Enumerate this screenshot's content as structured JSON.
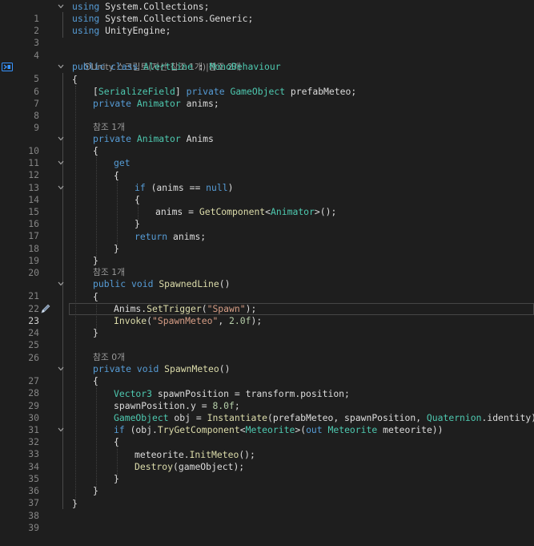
{
  "editor": {
    "lens": {
      "class_refs": "Unity 스크립트(자산 참조 1개)|참조 2개",
      "ref_1": "참조 1개",
      "ref_0": "참조 0개"
    },
    "line_numbers": [
      "1",
      "2",
      "3",
      "4",
      "5",
      "6",
      "7",
      "8",
      "9",
      "10",
      "11",
      "12",
      "13",
      "14",
      "15",
      "16",
      "17",
      "18",
      "19",
      "20",
      "21",
      "22",
      "23",
      "24",
      "25",
      "26",
      "27",
      "28",
      "29",
      "30",
      "31",
      "32",
      "33",
      "34",
      "35",
      "36",
      "37",
      "38",
      "39"
    ],
    "active_line": "23",
    "code": {
      "l1": {
        "t1": "using",
        "t2": " System.Collections;"
      },
      "l2": {
        "t1": "using",
        "t2": " System.Collections.Generic;"
      },
      "l3": {
        "t1": "using",
        "t2": " UnityEngine;"
      },
      "l5": {
        "t1": "public",
        "t2": " ",
        "t3": "class",
        "t4": " ",
        "t5": "AlertLine",
        "t6": " : ",
        "t7": "MonoBehaviour"
      },
      "l6": {
        "t1": "{"
      },
      "l7": {
        "t1": "[",
        "t2": "SerializeField",
        "t3": "] ",
        "t4": "private",
        "t5": " ",
        "t6": "GameObject",
        "t7": " prefabMeteo;"
      },
      "l8": {
        "t1": "private",
        "t2": " ",
        "t3": "Animator",
        "t4": " anims;"
      },
      "l10": {
        "t1": "private",
        "t2": " ",
        "t3": "Animator",
        "t4": " Anims"
      },
      "l11": {
        "t1": "{"
      },
      "l12": {
        "t1": "get"
      },
      "l13": {
        "t1": "{"
      },
      "l14": {
        "t1": "if",
        "t2": " (anims == ",
        "t3": "null",
        "t4": ")"
      },
      "l15": {
        "t1": "{"
      },
      "l16": {
        "t1": "anims = ",
        "t2": "GetComponent",
        "t3": "<",
        "t4": "Animator",
        "t5": ">();"
      },
      "l17": {
        "t1": "}"
      },
      "l18": {
        "t1": "return",
        "t2": " anims;"
      },
      "l19": {
        "t1": "}"
      },
      "l20": {
        "t1": "}"
      },
      "l21": {
        "t1": "public",
        "t2": " ",
        "t3": "void",
        "t4": " ",
        "t5": "SpawnedLine",
        "t6": "()"
      },
      "l22": {
        "t1": "{"
      },
      "l23": {
        "t1": "Anims.",
        "t2": "SetTrigger",
        "t3": "(",
        "t4": "\"Spawn\"",
        "t5": ");"
      },
      "l24": {
        "t1": "Invoke",
        "t2": "(",
        "t3": "\"SpawnMeteo\"",
        "t4": ", ",
        "t5": "2.0f",
        "t6": ");"
      },
      "l25": {
        "t1": "}"
      },
      "l27": {
        "t1": "private",
        "t2": " ",
        "t3": "void",
        "t4": " ",
        "t5": "SpawnMeteo",
        "t6": "()"
      },
      "l28": {
        "t1": "{"
      },
      "l29": {
        "t1": "Vector3",
        "t2": " spawnPosition = transform.position;"
      },
      "l30": {
        "t1": "spawnPosition.y = ",
        "t2": "8.0f",
        "t3": ";"
      },
      "l31": {
        "t1": "GameObject",
        "t2": " obj = ",
        "t3": "Instantiate",
        "t4": "(prefabMeteo, spawnPosition, ",
        "t5": "Quaternion",
        "t6": ".identity);"
      },
      "l32": {
        "t1": "if",
        "t2": " (obj.",
        "t3": "TryGetComponent",
        "t4": "<",
        "t5": "Meteorite",
        "t6": ">(",
        "t7": "out",
        "t8": " ",
        "t9": "Meteorite",
        "t10": " meteorite))"
      },
      "l33": {
        "t1": "{"
      },
      "l34": {
        "t1": "meteorite.",
        "t2": "InitMeteo",
        "t3": "();"
      },
      "l35": {
        "t1": "Destroy",
        "t2": "(gameObject);"
      },
      "l36": {
        "t1": "}"
      },
      "l37": {
        "t1": "}"
      },
      "l38": {
        "t1": "}"
      }
    },
    "colors": {
      "background": "#1e1e1e",
      "keyword": "#569cd6",
      "type": "#4ec9b0",
      "string": "#d69d85",
      "number": "#b5cea8",
      "method": "#dcdcaa"
    }
  }
}
